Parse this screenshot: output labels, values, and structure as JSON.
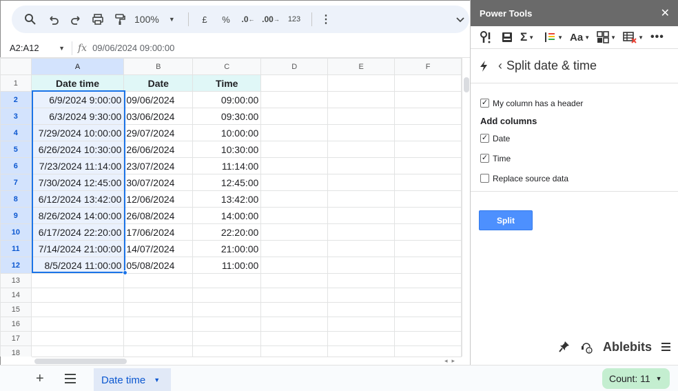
{
  "toolbar": {
    "zoom": "100%",
    "currency": "£",
    "percent": "%",
    "dec_decrease": ".0",
    "dec_increase": ".00",
    "format_123": "123"
  },
  "formula_bar": {
    "name_box": "A2:A12",
    "fx": "fx",
    "value": "09/06/2024 09:00:00"
  },
  "sheet": {
    "columns": [
      "A",
      "B",
      "C",
      "D",
      "E",
      "F"
    ],
    "header_row": [
      "Date time",
      "Date",
      "Time"
    ],
    "rows": [
      {
        "num": "2",
        "a": "6/9/2024 9:00:00",
        "b": "09/06/2024",
        "c": "09:00:00"
      },
      {
        "num": "3",
        "a": "6/3/2024 9:30:00",
        "b": "03/06/2024",
        "c": "09:30:00"
      },
      {
        "num": "4",
        "a": "7/29/2024 10:00:00",
        "b": "29/07/2024",
        "c": "10:00:00"
      },
      {
        "num": "5",
        "a": "6/26/2024 10:30:00",
        "b": "26/06/2024",
        "c": "10:30:00"
      },
      {
        "num": "6",
        "a": "7/23/2024 11:14:00",
        "b": "23/07/2024",
        "c": "11:14:00"
      },
      {
        "num": "7",
        "a": "7/30/2024 12:45:00",
        "b": "30/07/2024",
        "c": "12:45:00"
      },
      {
        "num": "8",
        "a": "6/12/2024 13:42:00",
        "b": "12/06/2024",
        "c": "13:42:00"
      },
      {
        "num": "9",
        "a": "8/26/2024 14:00:00",
        "b": "26/08/2024",
        "c": "14:00:00"
      },
      {
        "num": "10",
        "a": "6/17/2024 22:20:00",
        "b": "17/06/2024",
        "c": "22:20:00"
      },
      {
        "num": "11",
        "a": "7/14/2024 21:00:00",
        "b": "14/07/2024",
        "c": "21:00:00"
      },
      {
        "num": "12",
        "a": "8/5/2024 11:00:00",
        "b": "05/08/2024",
        "c": "11:00:00"
      }
    ],
    "empty_rows": [
      "13",
      "14",
      "15",
      "16",
      "17",
      "18"
    ]
  },
  "bottom": {
    "sheet_tab": "Date time",
    "count": "Count: 11"
  },
  "panel": {
    "title": "Power Tools",
    "tool_aa": "Aa",
    "subtitle": "Split date & time",
    "opt_header": "My column has a header",
    "add_columns": "Add columns",
    "opt_date": "Date",
    "opt_time": "Time",
    "opt_replace": "Replace source data",
    "split_label": "Split",
    "brand": "Ablebits"
  },
  "colors": {
    "accent": "#1a73e8",
    "header_fill": "#e0f7f7",
    "split_button": "#4d90fe",
    "count_badge": "#c4eed0"
  }
}
